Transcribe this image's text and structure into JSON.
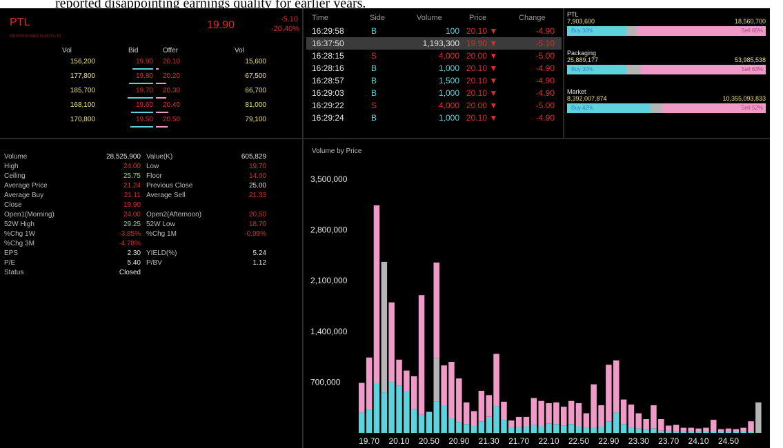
{
  "caption": "reported disappointing earnings quality for earlier years.",
  "quote": {
    "ticker": "PTL",
    "company": "PATUM POLYMER FILM CO LTD",
    "last": "19.90",
    "change": "-5.10",
    "change_pct": "-20.40%",
    "headers": [
      "Vol",
      "Bid",
      "Offer",
      "Vol"
    ],
    "book": [
      {
        "bid_vol": "156,200",
        "bid": "19.90",
        "offer": "20.10",
        "offer_vol": "15,600",
        "bid_bar": 0.6,
        "offer_bar": 0.0
      },
      {
        "bid_vol": "177,800",
        "bid": "19.80",
        "offer": "20.20",
        "offer_vol": "67,500",
        "bid_bar": 0.7,
        "offer_bar": 0.3
      },
      {
        "bid_vol": "185,700",
        "bid": "19.70",
        "offer": "20.30",
        "offer_vol": "66,700",
        "bid_bar": 0.75,
        "offer_bar": 0.3
      },
      {
        "bid_vol": "168,100",
        "bid": "19.60",
        "offer": "20.40",
        "offer_vol": "81,000",
        "bid_bar": 0.65,
        "offer_bar": 0.35
      },
      {
        "bid_vol": "170,800",
        "bid": "19.50",
        "offer": "20.50",
        "offer_vol": "79,100",
        "bid_bar": 0.67,
        "offer_bar": 0.34
      }
    ]
  },
  "trades": {
    "headers": [
      "Time",
      "Side",
      "Volume",
      "Price",
      "Change"
    ],
    "rows": [
      {
        "time": "16:29:58",
        "side": "B",
        "volume": "100",
        "price": "20.10 ▼",
        "change": "-4.90",
        "selected": false
      },
      {
        "time": "16:37:50",
        "side": "",
        "volume": "1,193,300",
        "price": "19.90 ▼",
        "change": "-5.10",
        "selected": true
      },
      {
        "time": "16:28:15",
        "side": "S",
        "volume": "4,000",
        "price": "20.00 ▼",
        "change": "-5.00",
        "selected": false
      },
      {
        "time": "16:28:16",
        "side": "B",
        "volume": "1,000",
        "price": "20.10 ▼",
        "change": "-4.90",
        "selected": false
      },
      {
        "time": "16:28:57",
        "side": "B",
        "volume": "1,500",
        "price": "20.10 ▼",
        "change": "-4.90",
        "selected": false
      },
      {
        "time": "16:29:03",
        "side": "B",
        "volume": "1,000",
        "price": "20.10 ▼",
        "change": "-4.90",
        "selected": false
      },
      {
        "time": "16:29:22",
        "side": "S",
        "volume": "4,000",
        "price": "20.00 ▼",
        "change": "-5.00",
        "selected": false
      },
      {
        "time": "16:29:24",
        "side": "B",
        "volume": "1,000",
        "price": "20.10 ▼",
        "change": "-4.90",
        "selected": false
      }
    ]
  },
  "ratios": [
    {
      "name": "PTL",
      "buy_vol": "7,903,600",
      "sell_vol": "18,560,700",
      "buy_label": "Buy 30%",
      "sell_label": "Sell 65%",
      "buy": 0.3,
      "gray": 0.05
    },
    {
      "name": "Packaging",
      "buy_vol": "25,889,177",
      "sell_vol": "53,985,538",
      "buy_label": "Buy 30%",
      "sell_label": "Sell 63%",
      "buy": 0.3,
      "gray": 0.07
    },
    {
      "name": "Market",
      "buy_vol": "8,392,007,874",
      "sell_vol": "10,355,093,833",
      "buy_label": "Buy 42%",
      "sell_label": "Sell 52%",
      "buy": 0.42,
      "gray": 0.06
    }
  ],
  "stats": [
    {
      "l1": "Volume",
      "v1": "28,525,900",
      "c1": "#e6e6e6",
      "l2": "Value(K)",
      "v2": "605,829",
      "c2": "#e6e6e6"
    },
    {
      "l1": "High",
      "v1": "24.00",
      "c1": "#e02b2b",
      "l2": "Low",
      "v2": "19.70",
      "c2": "#e02b2b"
    },
    {
      "l1": "Ceiling",
      "v1": "25.75",
      "c1": "#7ee07e",
      "l2": "Floor",
      "v2": "14.00",
      "c2": "#e02b2b"
    },
    {
      "l1": "Average Price",
      "v1": "21.24",
      "c1": "#e02b2b",
      "l2": "Previous Close",
      "v2": "25.00",
      "c2": "#e6e6e6"
    },
    {
      "l1": "Average Buy",
      "v1": "21.11",
      "c1": "#e02b2b",
      "l2": "Average Sell",
      "v2": "21.33",
      "c2": "#e02b2b"
    },
    {
      "l1": "Close",
      "v1": "19.90",
      "c1": "#e02b2b",
      "l2": "",
      "v2": "",
      "c2": "#e6e6e6"
    },
    {
      "l1": "Open1(Morning)",
      "v1": "24.00",
      "c1": "#e02b2b",
      "l2": "Open2(Afternoon)",
      "v2": "20.50",
      "c2": "#e02b2b"
    },
    {
      "l1": "52W High",
      "v1": "29.25",
      "c1": "#7ee07e",
      "l2": "52W Low",
      "v2": "18.70",
      "c2": "#e02b2b"
    },
    {
      "l1": "%Chg 1W",
      "v1": "-3.85%",
      "c1": "#e02b2b",
      "l2": "%Chg 1M",
      "v2": "-0.99%",
      "c2": "#e02b2b"
    },
    {
      "l1": "%Chg 3M",
      "v1": "-4.78%",
      "c1": "#e02b2b",
      "l2": "",
      "v2": "",
      "c2": "#e6e6e6"
    },
    {
      "l1": "EPS",
      "v1": "2.30",
      "c1": "#e6e6e6",
      "l2": "YIELD(%)",
      "v2": "5.24",
      "c2": "#e6e6e6"
    },
    {
      "l1": "P/E",
      "v1": "5.40",
      "c1": "#e6e6e6",
      "l2": "P/BV",
      "v2": "1.12",
      "c2": "#e6e6e6"
    },
    {
      "l1": "Status",
      "v1": "Closed",
      "c1": "#e6e6e6",
      "l2": "",
      "v2": "",
      "c2": "#e6e6e6"
    }
  ],
  "chart_data": {
    "type": "bar",
    "title": "Volume by Price",
    "ylim": [
      0,
      3500000
    ],
    "yticks": [
      "3,500,000",
      "2,800,000",
      "2,100,000",
      "1,400,000",
      "700,000"
    ],
    "ytick_values": [
      3500000,
      2800000,
      2100000,
      1400000,
      700000
    ],
    "xtick_labels": [
      "19.70",
      "20.10",
      "20.50",
      "20.90",
      "21.30",
      "21.70",
      "22.10",
      "22.50",
      "22.90",
      "23.30",
      "23.70",
      "24.10",
      "24.50"
    ],
    "colors": {
      "buy": "#5fd3dd",
      "sell": "#f09ac8",
      "open": "#b5b5b5"
    },
    "categories": [
      "19.60",
      "19.70",
      "19.80",
      "19.90",
      "20.00",
      "20.10",
      "20.20",
      "20.30",
      "20.40",
      "20.50",
      "20.60",
      "20.70",
      "20.80",
      "20.90",
      "21.00",
      "21.10",
      "21.20",
      "21.30",
      "21.40",
      "21.50",
      "21.60",
      "21.70",
      "21.80",
      "21.90",
      "22.00",
      "22.10",
      "22.20",
      "22.30",
      "22.40",
      "22.50",
      "22.60",
      "22.70",
      "22.80",
      "22.90",
      "23.00",
      "23.10",
      "23.20",
      "23.30",
      "23.40",
      "23.50",
      "23.60",
      "23.70",
      "23.80",
      "23.90",
      "24.00",
      "24.10",
      "24.20",
      "24.30",
      "24.40",
      "24.50",
      "24.60",
      "24.70",
      "24.80",
      "24.90"
    ],
    "series": [
      {
        "name": "buy",
        "values": [
          280000,
          320000,
          690000,
          560000,
          700000,
          650000,
          580000,
          330000,
          250000,
          290000,
          430000,
          380000,
          200000,
          150000,
          120000,
          100000,
          160000,
          220000,
          370000,
          180000,
          80000,
          80000,
          90000,
          110000,
          90000,
          130000,
          120000,
          100000,
          120000,
          90000,
          70000,
          70000,
          90000,
          160000,
          280000,
          120000,
          80000,
          60000,
          40000,
          60000,
          30000,
          30000,
          20000,
          20000,
          10000,
          20000,
          10000,
          10000,
          20000,
          20000,
          10000,
          10000,
          10000,
          0
        ]
      },
      {
        "name": "sell",
        "values": [
          410000,
          720000,
          2450000,
          0,
          1100000,
          360000,
          280000,
          450000,
          1650000,
          0,
          1320000,
          550000,
          780000,
          600000,
          300000,
          200000,
          420000,
          300000,
          720000,
          250000,
          90000,
          140000,
          130000,
          370000,
          350000,
          280000,
          300000,
          260000,
          320000,
          320000,
          200000,
          600000,
          290000,
          780000,
          720000,
          340000,
          310000,
          210000,
          150000,
          320000,
          160000,
          70000,
          90000,
          50000,
          60000,
          40000,
          60000,
          170000,
          30000,
          40000,
          40000,
          60000,
          150000,
          0
        ]
      },
      {
        "name": "open",
        "values": [
          0,
          0,
          0,
          1800000,
          0,
          0,
          0,
          0,
          0,
          0,
          600000,
          0,
          0,
          0,
          0,
          0,
          0,
          0,
          0,
          0,
          0,
          0,
          0,
          0,
          0,
          0,
          0,
          0,
          0,
          0,
          0,
          0,
          0,
          0,
          0,
          0,
          0,
          0,
          0,
          0,
          0,
          0,
          0,
          0,
          0,
          0,
          0,
          0,
          0,
          0,
          0,
          0,
          0,
          420000
        ]
      }
    ]
  }
}
